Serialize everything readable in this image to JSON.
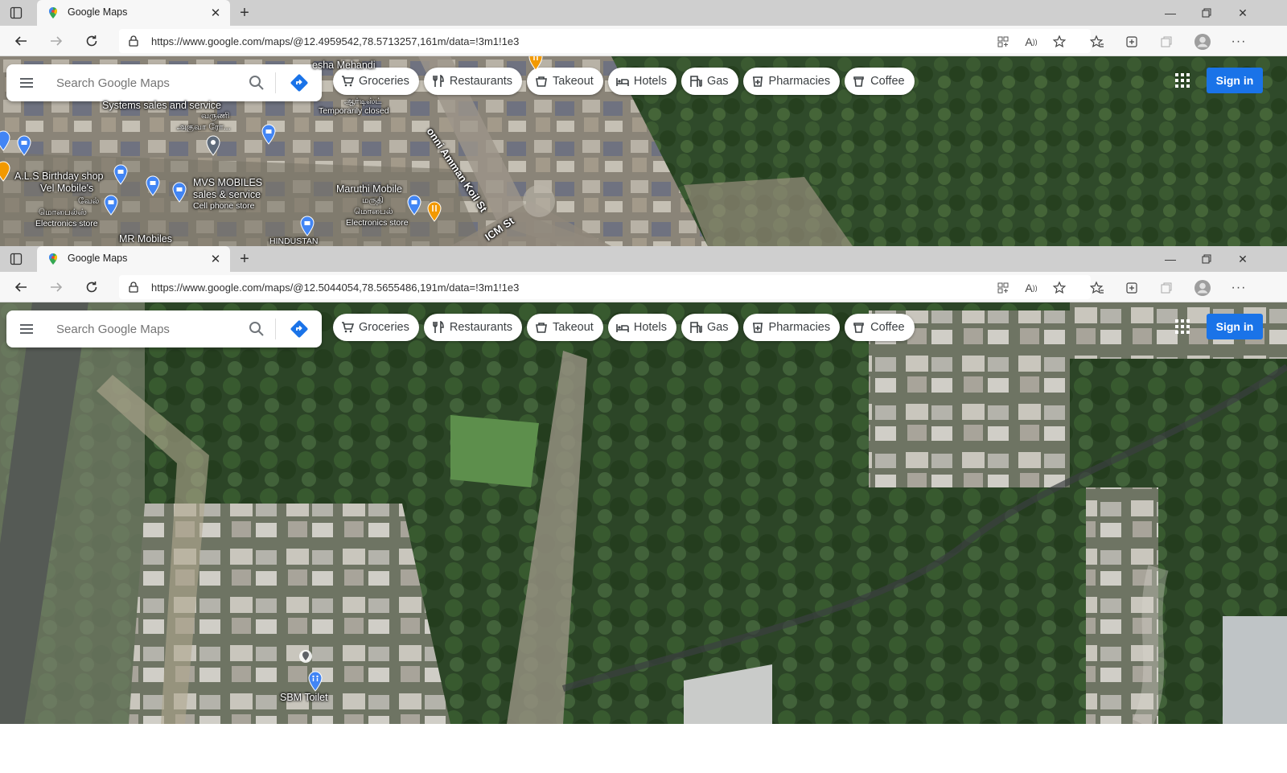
{
  "windows": [
    {
      "tab": {
        "title": "Google Maps"
      },
      "url": "https://www.google.com/maps/@12.4959542,78.5713257,161m/data=!3m1!1e3",
      "search": {
        "placeholder": "Search Google Maps"
      },
      "chips": [
        {
          "label": "Groceries",
          "icon": "cart-icon"
        },
        {
          "label": "Restaurants",
          "icon": "fork-knife-icon"
        },
        {
          "label": "Takeout",
          "icon": "takeout-icon"
        },
        {
          "label": "Hotels",
          "icon": "bed-icon"
        },
        {
          "label": "Gas",
          "icon": "gas-pump-icon"
        },
        {
          "label": "Pharmacies",
          "icon": "pharmacy-icon"
        },
        {
          "label": "Coffee",
          "icon": "coffee-icon"
        }
      ],
      "signin": "Sign in",
      "map_labels": {
        "mehandi": "esha Mehandi",
        "systems": "Systems sales and service",
        "temporarily_closed": "Temporarily closed",
        "tamil_1": "அகுவா ரோ...",
        "tamil_2": "வருணி",
        "tamil_3": "ஆர்டிஸ்ட்",
        "als": "A.L.S Birthday shop",
        "vel": "Vel Mobile's",
        "vel_ta": "வேல்",
        "vel_ta2": "மொபைல்ஸ்",
        "electronics_1": "Electronics store",
        "mvs": "MVS MOBILES",
        "mvs_sub": "sales & service",
        "cell": "Cell phone store",
        "maruthi": "Maruthi Mobile",
        "maruthi_ta": "மருதி",
        "maruthi_ta2": "மொபைல்",
        "electronics_2": "Electronics store",
        "mr": "MR Mobiles",
        "hindustan": "HINDUSTAN",
        "road1": "onni Amman Koil St",
        "road2": "ICM St"
      }
    },
    {
      "tab": {
        "title": "Google Maps"
      },
      "url": "https://www.google.com/maps/@12.5044054,78.5655486,191m/data=!3m1!1e3",
      "search": {
        "placeholder": "Search Google Maps"
      },
      "chips": [
        {
          "label": "Groceries",
          "icon": "cart-icon"
        },
        {
          "label": "Restaurants",
          "icon": "fork-knife-icon"
        },
        {
          "label": "Takeout",
          "icon": "takeout-icon"
        },
        {
          "label": "Hotels",
          "icon": "bed-icon"
        },
        {
          "label": "Gas",
          "icon": "gas-pump-icon"
        },
        {
          "label": "Pharmacies",
          "icon": "pharmacy-icon"
        },
        {
          "label": "Coffee",
          "icon": "coffee-icon"
        }
      ],
      "signin": "Sign in",
      "map_labels": {
        "sbm": "SBM Toilet"
      }
    }
  ],
  "colors": {
    "signin_blue": "#1a73e8",
    "directions_blue": "#1a73e8",
    "pin_blue": "#4285f4",
    "pin_orange": "#f29900"
  }
}
